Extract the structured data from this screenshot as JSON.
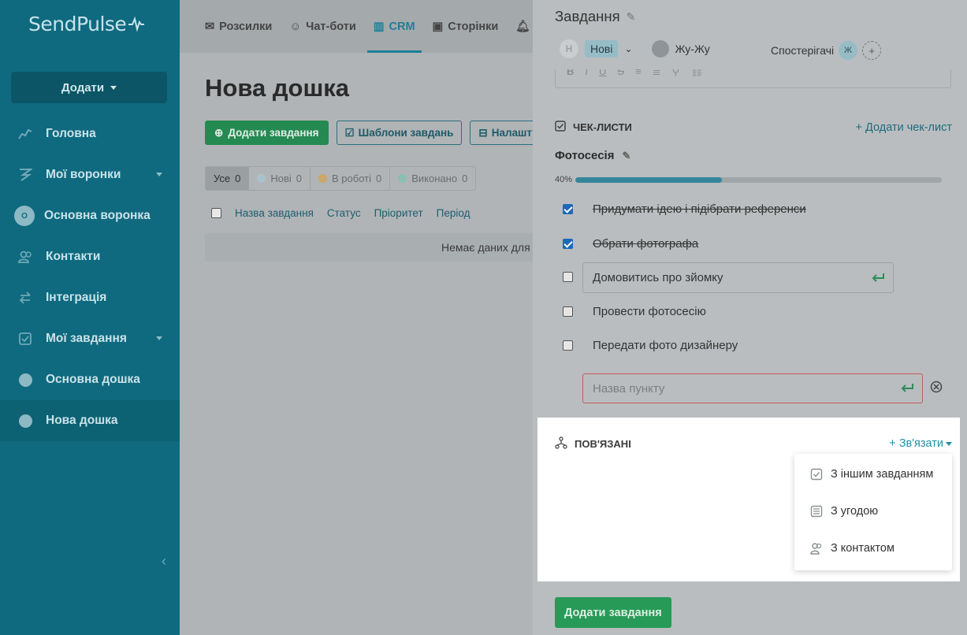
{
  "app": {
    "logo_text": "SendPulse"
  },
  "sidebar": {
    "add_label": "Додати",
    "items": [
      {
        "label": "Головна",
        "icon": "chart-line-icon"
      },
      {
        "label": "Мої воронки",
        "icon": "funnel-icon",
        "has_submenu": true
      },
      {
        "label": "Основна воронка",
        "icon": "avatar-icon",
        "avatar_text": "O"
      },
      {
        "label": "Контакти",
        "icon": "users-icon"
      },
      {
        "label": "Інтеграція",
        "icon": "exchange-icon"
      },
      {
        "label": "Мої завдання",
        "icon": "checkbox-icon",
        "has_submenu": true
      },
      {
        "label": "Основна дошка",
        "icon": "dot-icon"
      },
      {
        "label": "Нова дошка",
        "icon": "dot-icon",
        "active": true
      }
    ]
  },
  "topnav": {
    "tabs": [
      {
        "label": "Розсилки",
        "icon": "mail-icon"
      },
      {
        "label": "Чат-боти",
        "icon": "chat-icon"
      },
      {
        "label": "CRM",
        "icon": "crm-icon",
        "active": true
      },
      {
        "label": "Сторінки",
        "icon": "page-icon"
      }
    ]
  },
  "board": {
    "title": "Нова дошка",
    "buttons": {
      "add_task": "Додати завдання",
      "templates": "Шаблони завдань",
      "settings": "Налаштування"
    },
    "filters": [
      {
        "label": "Усе",
        "count": "0",
        "active": true
      },
      {
        "label": "Нові",
        "count": "0",
        "color": "#a9c3cc"
      },
      {
        "label": "В роботі",
        "count": "0",
        "color": "#c9a86a"
      },
      {
        "label": "Виконано",
        "count": "0",
        "color": "#8ac0b0"
      }
    ],
    "columns": [
      "Назва завдання",
      "Статус",
      "Пріоритет",
      "Період"
    ],
    "empty_text": "Немає даних для відображення"
  },
  "panel": {
    "title": "Завдання",
    "status": {
      "avatar_letter": "Н",
      "label": "Нові"
    },
    "owner": "Жу-Жу",
    "watchers_label": "Спостерігачі",
    "watcher_initial": "Ж",
    "watcher_add": "+",
    "toolbar": [
      "B",
      "I",
      "U",
      "S",
      "≡",
      "≣",
      "⚲",
      "⛓"
    ],
    "checklists": {
      "section_title": "ЧЕК-ЛИСТИ",
      "add_label": "+ Додати чек-лист",
      "name": "Фотосесія",
      "progress_label": "40%",
      "progress_value": 0.4,
      "items": [
        {
          "text": "Придумати ідею і підібрати референси",
          "checked": true
        },
        {
          "text": "Обрати фотографа",
          "checked": true
        },
        {
          "text": "Домовитись про зйомку",
          "checked": false,
          "editing": true
        },
        {
          "text": "Провести фотосесію",
          "checked": false
        },
        {
          "text": "Передати фото дизайнеру",
          "checked": false
        }
      ],
      "new_item_placeholder": "Назва пункту"
    },
    "linked": {
      "section_title": "ПОВ'ЯЗАНІ",
      "link_label": "+ Зв'язати",
      "menu": [
        {
          "label": "З іншим завданням",
          "icon": "task-icon"
        },
        {
          "label": "З угодою",
          "icon": "deal-icon"
        },
        {
          "label": "З контактом",
          "icon": "contact-icon"
        }
      ]
    },
    "submit_label": "Додати завдання"
  }
}
